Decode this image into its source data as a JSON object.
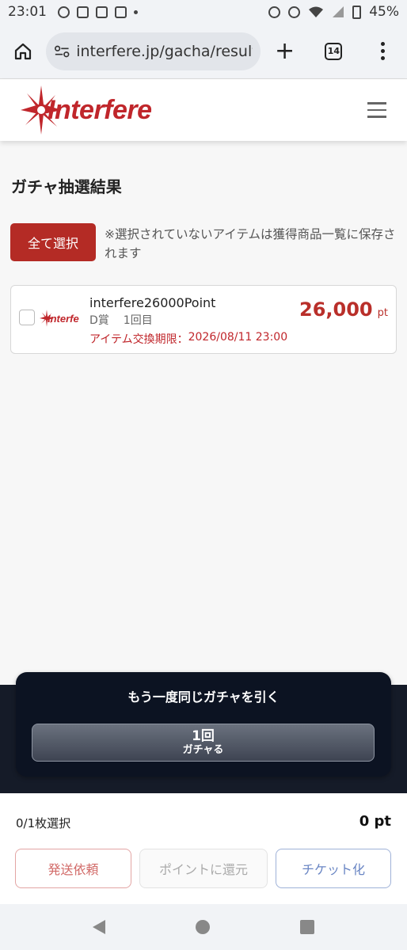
{
  "status_bar": {
    "time": "23:01",
    "battery": "45%"
  },
  "browser": {
    "url": "interfere.jp/gacha/result?",
    "tab_count": "14",
    "new_tab_label": "+"
  },
  "site": {
    "logo_text": "Interfere"
  },
  "page": {
    "title": "ガチャ抽選結果",
    "select_all_label": "全て選択",
    "notice": "※選択されていないアイテムは獲得商品一覧に保存されます"
  },
  "item": {
    "thumb_text": "Interfe",
    "name": "interfere26000Point",
    "rank": "D賞",
    "draw": "1回目",
    "expiry_label": "アイテム交換期限：",
    "expiry_value": "2026/08/11 23:00",
    "price": "26,000",
    "price_unit": "pt"
  },
  "gacha": {
    "title": "もう一度同じガチャを引く",
    "button_count": "1回",
    "button_sub": "ガチャる"
  },
  "footer": {
    "selected": "0/1枚選択",
    "total": "0 pt",
    "send_label": "発送依頼",
    "point_label": "ポイントに還元",
    "ticket_label": "チケット化"
  },
  "colors": {
    "brand_red": "#b42b25",
    "banner_dark": "#0c1322"
  }
}
